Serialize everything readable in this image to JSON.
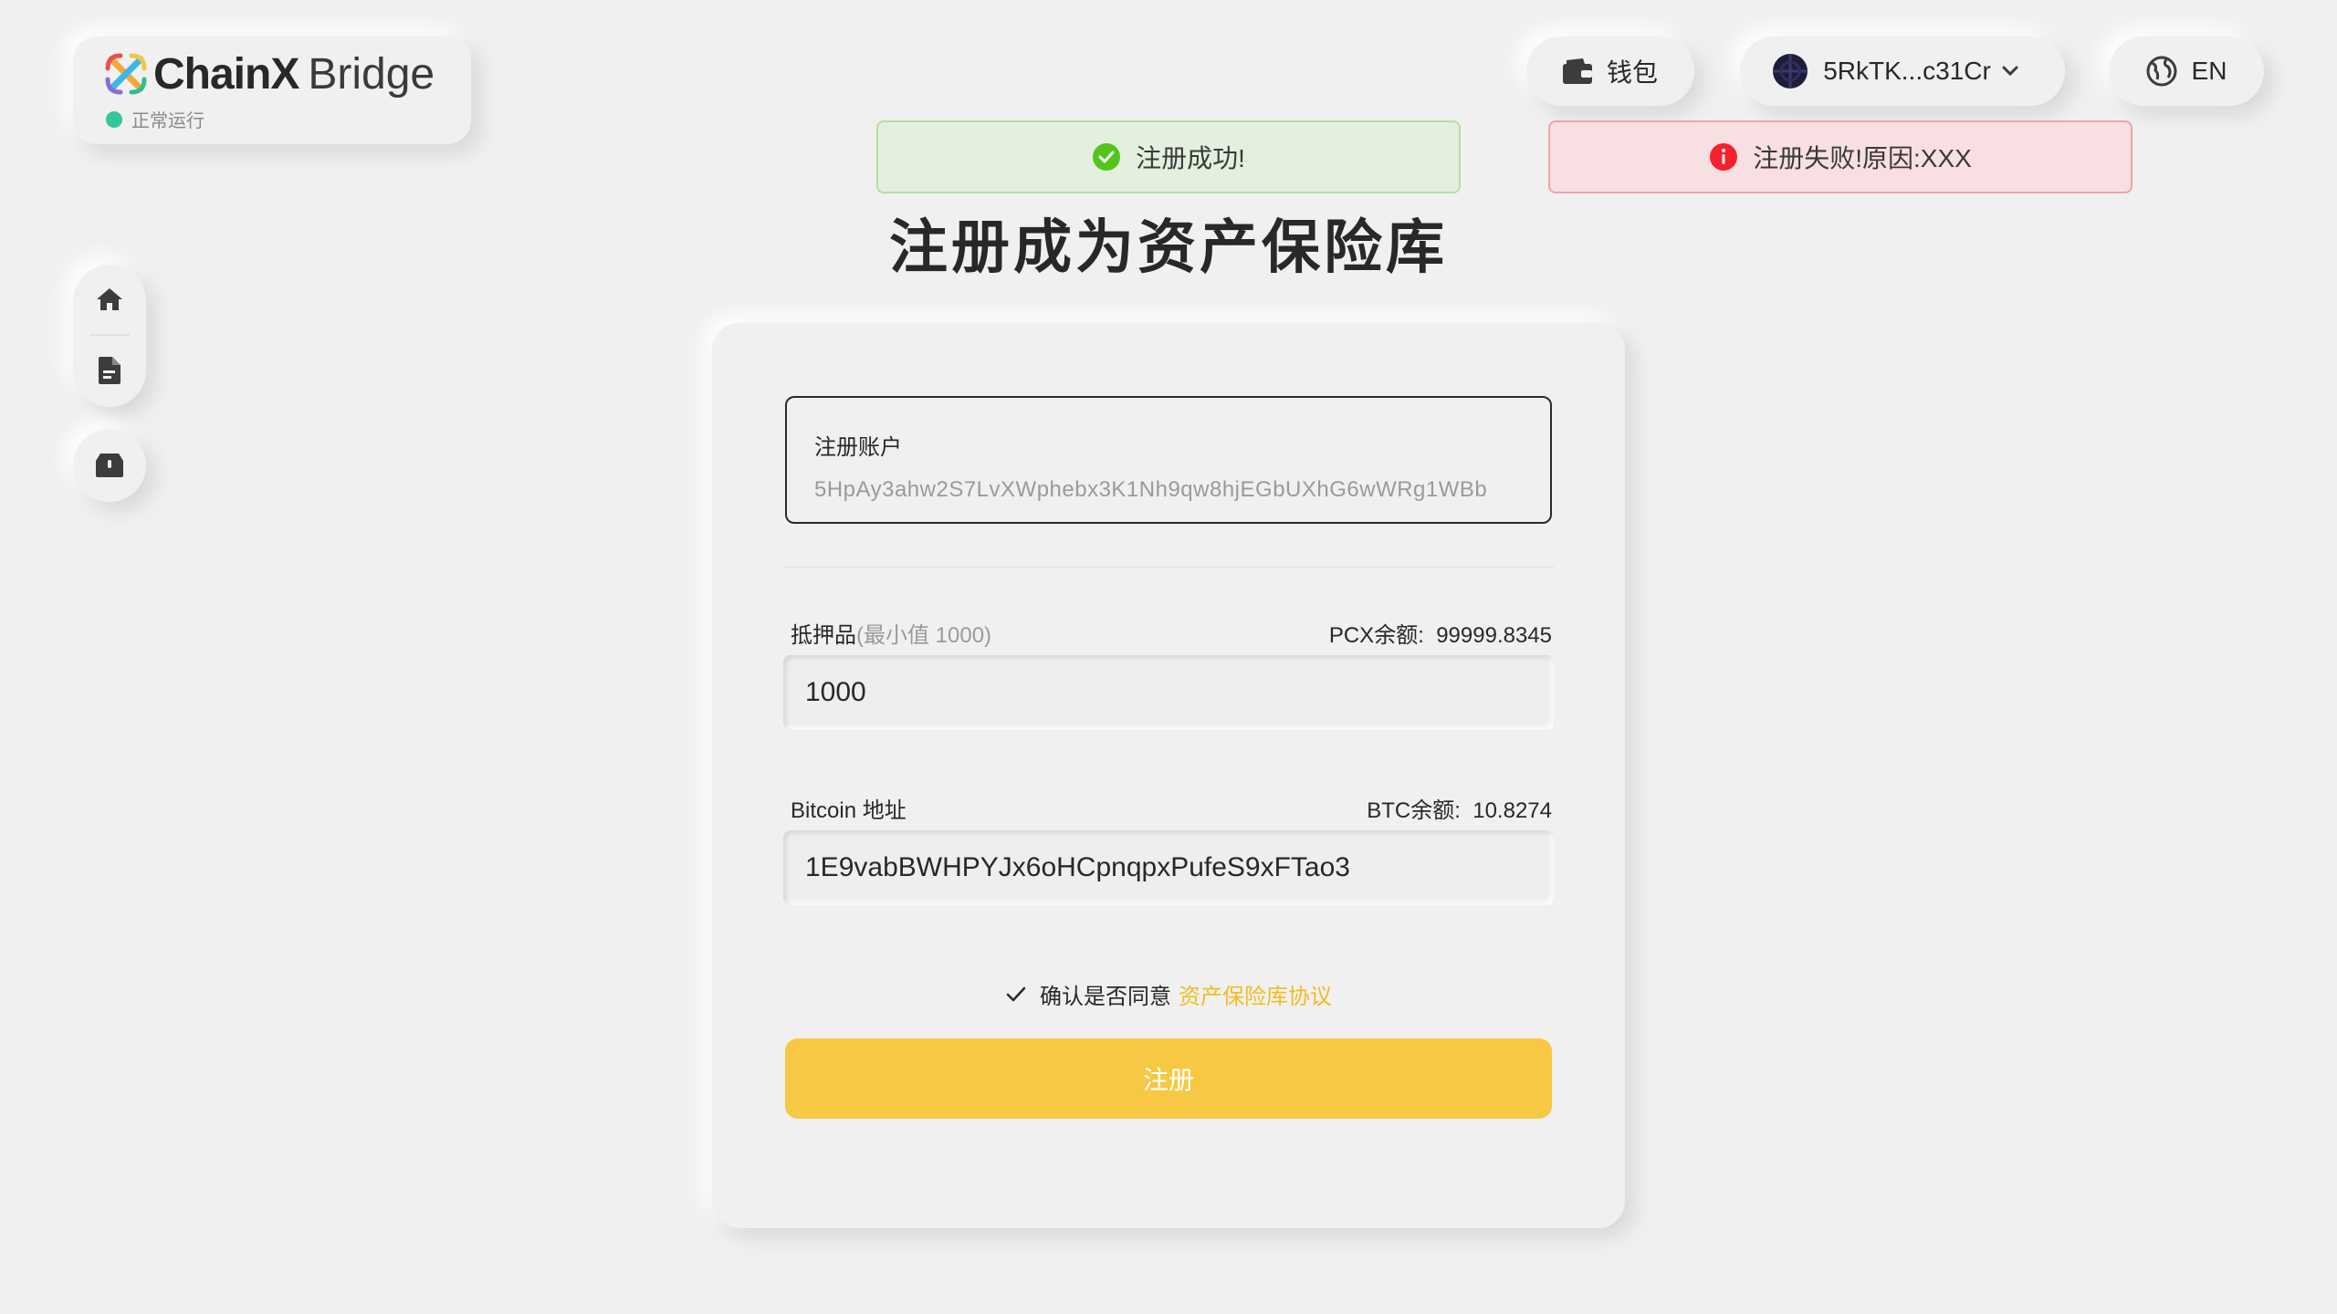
{
  "logo": {
    "brand_bold": "ChainX",
    "brand_light": "Bridge",
    "status_text": "正常运行",
    "status_color": "#34c69a"
  },
  "nav": {
    "items": [
      {
        "icon": "home-icon"
      },
      {
        "icon": "document-icon"
      },
      {
        "icon": "vault-icon"
      }
    ]
  },
  "header": {
    "wallet_label": "钱包",
    "account_label": "5RkTK...c31Cr",
    "language_label": "EN"
  },
  "alerts": {
    "success_text": "注册成功!",
    "error_text": "注册失败!原因:XXX",
    "success_color": "#52c41a",
    "error_color": "#f5222d"
  },
  "page_title": "注册成为资产保险库",
  "form": {
    "account_label": "注册账户",
    "account_value": "5HpAy3ahw2S7LvXWphebx3K1Nh9qw8hjEGbUXhG6wWRg1WBb",
    "collateral_label": "抵押品",
    "collateral_hint": "(最小值 1000)",
    "pcx_balance_label": "PCX余额:",
    "pcx_balance_value": "99999.8345",
    "collateral_value": "1000",
    "btc_address_label": "Bitcoin 地址",
    "btc_balance_label": "BTC余额:",
    "btc_balance_value": "10.8274",
    "btc_address_value": "1E9vabBWHPYJx6oHCpnqpxPufeS9xFTao3",
    "agree_text": "确认是否同意",
    "agree_link": "资产保险库协议",
    "agree_checked": true,
    "submit_label": "注册",
    "accent_color": "#f6c844"
  }
}
